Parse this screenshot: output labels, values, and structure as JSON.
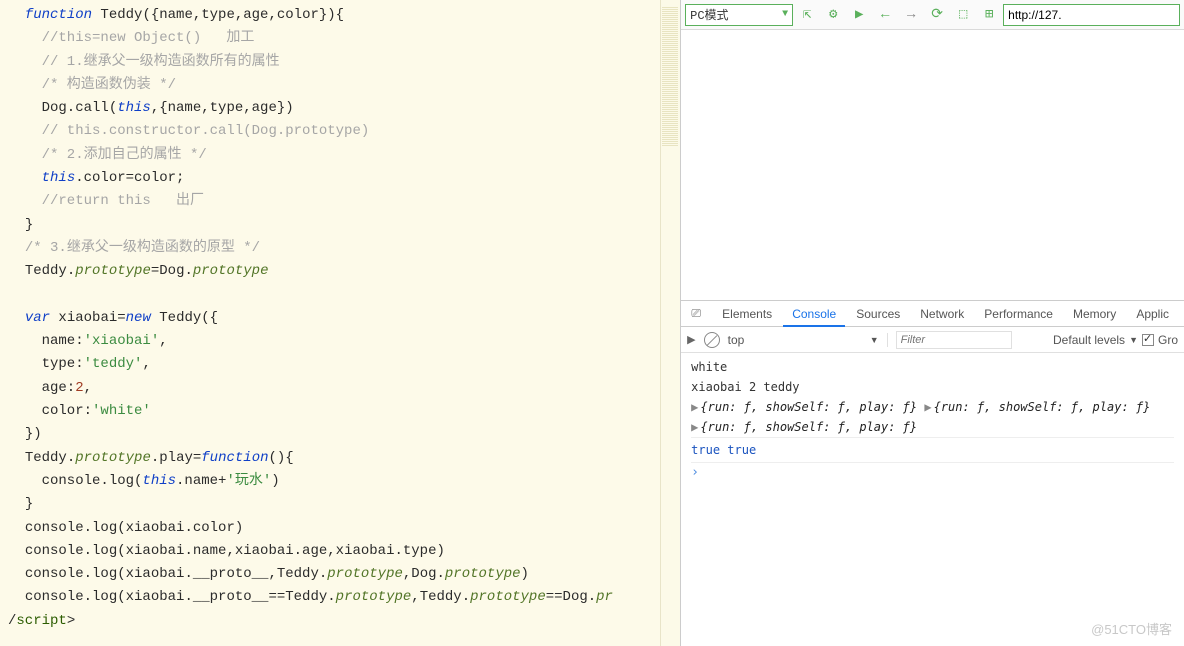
{
  "code": {
    "l1a": "function",
    "l1b": " Teddy({name,type,age,color}){",
    "l2": "    //this=new Object()   加工",
    "l3": "    // 1.继承父一级构造函数所有的属性",
    "l4": "    /* 构造函数伪装 */",
    "l5a": "    Dog.call(",
    "l5b": "this",
    "l5c": ",{name,type,age})",
    "l6": "    // this.constructor.call(Dog.prototype)",
    "l7": "    /* 2.添加自己的属性 */",
    "l8a": "    ",
    "l8b": "this",
    "l8c": ".color=color;",
    "l9": "    //return this   出厂",
    "l10": "}",
    "l11": "/* 3.继承父一级构造函数的原型 */",
    "l12a": "Teddy.",
    "l12b": "prototype",
    "l12c": "=Dog.",
    "l12d": "prototype",
    "l13": "",
    "l14a": "var",
    "l14b": " xiaobai=",
    "l14c": "new",
    "l14d": " Teddy({",
    "l15a": "    name:",
    "l15b": "'xiaobai'",
    "l15c": ",",
    "l16a": "    type:",
    "l16b": "'teddy'",
    "l16c": ",",
    "l17a": "    age:",
    "l17b": "2",
    "l17c": ",",
    "l18a": "    color:",
    "l18b": "'white'",
    "l19": "})",
    "l20a": "Teddy.",
    "l20b": "prototype",
    "l20c": ".play=",
    "l20d": "function",
    "l20e": "(){",
    "l21a": "    console.log(",
    "l21b": "this",
    "l21c": ".name+",
    "l21d": "'玩水'",
    "l21e": ")",
    "l22": "}",
    "l23": "console.log(xiaobai.color)",
    "l24": "console.log(xiaobai.name,xiaobai.age,xiaobai.type)",
    "l25a": "console.log(xiaobai.__proto__,Teddy.",
    "l25b": "prototype",
    "l25c": ",Dog.",
    "l25d": "prototype",
    "l25e": ")",
    "l26a": "console.log(xiaobai.__proto__==Teddy.",
    "l26b": "prototype",
    "l26c": ",Teddy.",
    "l26d": "prototype",
    "l26e": "==Dog.",
    "l26f": "pr",
    "l27a": "/",
    "l27b": "script",
    "l27c": ">"
  },
  "toolbar": {
    "mode": "PC模式",
    "url": "http://127."
  },
  "devtools": {
    "tabs": {
      "elements": "Elements",
      "console": "Console",
      "sources": "Sources",
      "network": "Network",
      "performance": "Performance",
      "memory": "Memory",
      "application": "Applic"
    },
    "context": "top",
    "filter_ph": "Filter",
    "levels": "Default levels",
    "group": "Gro"
  },
  "console": {
    "l1": "white",
    "l2": "xiaobai 2 teddy",
    "l3a": "{run: ƒ, showSelf: ƒ, play: ƒ}",
    "l3b": "{run: ƒ, showSelf: ƒ, play: ƒ}",
    "l4": "{run: ƒ, showSelf: ƒ, play: ƒ}",
    "l5": "true true"
  },
  "watermark": "@51CTO博客"
}
